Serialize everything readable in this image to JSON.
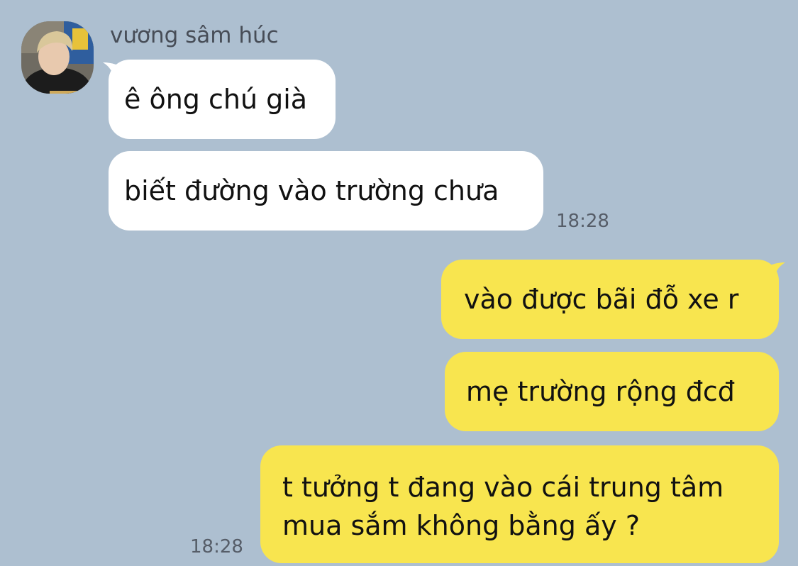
{
  "chat": {
    "sender_name": "vương sâm húc",
    "incoming": [
      {
        "text": "ê ông chú già"
      },
      {
        "text": "biết đường vào trường chưa"
      }
    ],
    "incoming_time": "18:28",
    "outgoing": [
      {
        "text": "vào được bãi đỗ xe r"
      },
      {
        "text": "mẹ trường rộng đcđ"
      },
      {
        "text": "t tưởng t đang vào cái trung tâm mua sắm không bằng ấy ?"
      }
    ],
    "outgoing_time": "18:28"
  },
  "colors": {
    "background": "#adbfd0",
    "incoming_bubble": "#ffffff",
    "outgoing_bubble": "#f8e54f"
  }
}
